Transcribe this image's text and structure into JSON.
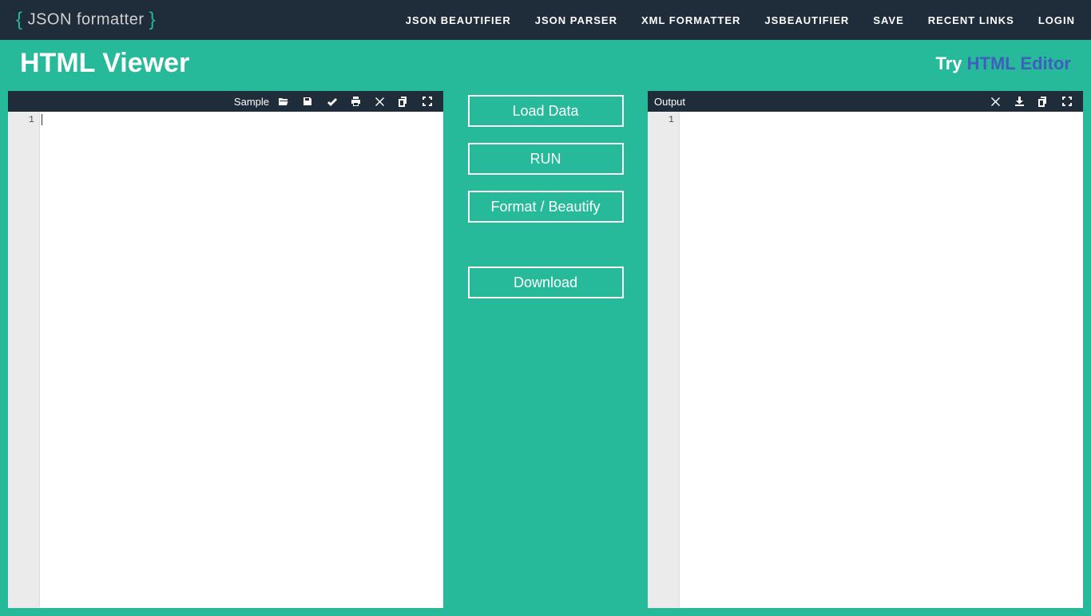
{
  "logo": {
    "text_json": "JSON",
    "text_formatter": "formatter"
  },
  "nav": {
    "json_beautifier": "JSON BEAUTIFIER",
    "json_parser": "JSON PARSER",
    "xml_formatter": "XML FORMATTER",
    "jsbeautifier": "JSBEAUTIFIER",
    "save": "SAVE",
    "recent_links": "RECENT LINKS",
    "login": "LOGIN"
  },
  "page_title": "HTML Viewer",
  "try_link": {
    "try": "Try ",
    "editor": "HTML Editor"
  },
  "input_pane": {
    "label": "Sample",
    "line_number": "1"
  },
  "output_pane": {
    "label": "Output",
    "line_number": "1"
  },
  "actions": {
    "load_data": "Load Data",
    "run": "RUN",
    "format": "Format / Beautify",
    "download": "Download"
  }
}
